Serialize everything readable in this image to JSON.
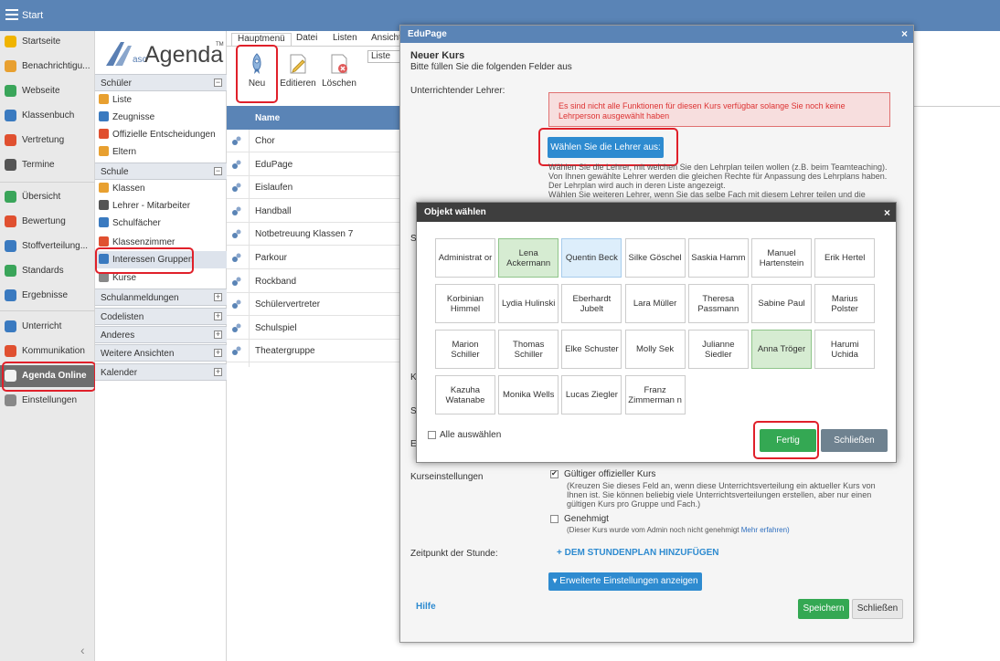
{
  "app": {
    "title": "Start"
  },
  "nav": {
    "items": [
      {
        "label": "Startseite",
        "icon": "star-icon",
        "color": "#f0b400"
      },
      {
        "label": "Benachrichtigu...",
        "icon": "envelope-icon",
        "color": "#e8a030"
      },
      {
        "label": "Webseite",
        "icon": "house-icon",
        "color": "#3aa55a"
      },
      {
        "label": "Klassenbuch",
        "icon": "book-icon",
        "color": "#3a7ac0"
      },
      {
        "label": "Vertretung",
        "icon": "person-icon",
        "color": "#e05030"
      },
      {
        "label": "Termine",
        "icon": "calendar-icon",
        "color": "#555555"
      },
      {
        "label": "Übersicht",
        "icon": "check-circle-icon",
        "color": "#3aa55a"
      },
      {
        "label": "Bewertung",
        "icon": "grade-icon",
        "color": "#e05030"
      },
      {
        "label": "Stoffverteilung...",
        "icon": "list-icon",
        "color": "#3a7ac0"
      },
      {
        "label": "Standards",
        "icon": "shield-icon",
        "color": "#3aa55a"
      },
      {
        "label": "Ergebnisse",
        "icon": "bar-chart-icon",
        "color": "#3a7ac0"
      },
      {
        "label": "Unterricht",
        "icon": "monitor-icon",
        "color": "#3a7ac0"
      },
      {
        "label": "Kommunikation",
        "icon": "chat-icon",
        "color": "#e05030"
      },
      {
        "label": "Agenda Online",
        "icon": "agenda-icon",
        "color": "#ffffff"
      },
      {
        "label": "Einstellungen",
        "icon": "gear-icon",
        "color": "#888888"
      }
    ]
  },
  "logo": {
    "asc": "asc",
    "agenda": "Agenda",
    "tm": "TM"
  },
  "tree": {
    "schueler_header": "Schüler",
    "schueler_items": [
      "Liste",
      "Zeugnisse",
      "Offizielle Entscheidungen",
      "Eltern"
    ],
    "schule_header": "Schule",
    "schule_items": [
      "Klassen",
      "Lehrer - Mitarbeiter",
      "Schulfächer",
      "Klassenzimmer",
      "Interessen Gruppen",
      "Kurse"
    ],
    "collapsed": [
      "Schulanmeldungen",
      "Codelisten",
      "Anderes",
      "Weitere Ansichten",
      "Kalender"
    ],
    "expand_glyph": "+",
    "collapse_glyph": "−"
  },
  "tabs": [
    "Hauptmenü",
    "Datei",
    "Listen",
    "Ansicht"
  ],
  "toolbar": {
    "new": "Neu",
    "edit": "Editieren",
    "delete": "Löschen",
    "liste": "Liste"
  },
  "list": {
    "header": "Name",
    "rows": [
      "Chor",
      "EduPage",
      "Eislaufen",
      "Handball",
      "Notbetreuung Klassen 7",
      "Parkour",
      "Rockband",
      "Schülervertreter",
      "Schulspiel",
      "Theatergruppe"
    ]
  },
  "edupage": {
    "title": "EduPage",
    "close": "×",
    "heading": "Neuer Kurs",
    "subheading": "Bitte füllen Sie die folgenden Felder aus",
    "teacher_label": "Unterrichtender Lehrer:",
    "alert": [
      "Es sind nicht alle Funktionen für diesen Kurs verfügbar solange Sie noch keine",
      "Lehrperson ausgewählt haben"
    ],
    "choose_button": "Wählen Sie die Lehrer aus:",
    "info": [
      "Wählen Sie die Lehrer, mit welchen Sie den Lehrplan teilen wollen (z.B. beim Teamteaching).",
      "Von Ihnen gewählte Lehrer werden die gleichen Rechte für Anpassung des Lehrplans haben.",
      "Der Lehrplan wird auch in deren Liste angezeigt.",
      "Wählen Sie weiteren Lehrer, wenn Sie das selbe Fach mit diesem Lehrer teilen und die"
    ],
    "row_letters": [
      "S",
      "K",
      "S",
      "E"
    ],
    "settings_label": "Kurseinstellungen",
    "official_label": "Gültiger offizieller Kurs",
    "official_help": [
      "(Kreuzen Sie dieses Feld an, wenn diese Unterrichtsverteilung ein aktueller Kurs von",
      "Ihnen ist. Sie können beliebig viele Unterrichtsverteilungen erstellen, aber nur einen",
      "gültigen Kurs pro Gruppe und Fach.)"
    ],
    "approved_label": "Genehmigt",
    "approved_help": "(Dieser Kurs wurde vom Admin noch nicht genehmigt",
    "approved_link": "Mehr erfahren)",
    "lesson_time_label": "Zeitpunkt der Stunde:",
    "add_to_schedule": "+ DEM STUNDENPLAN HINZUFÜGEN",
    "advanced_button": "Erweiterte Einstellungen anzeigen",
    "help": "Hilfe",
    "save": "Speichern",
    "close_button": "Schließen",
    "official_checked": true,
    "approved_checked": false
  },
  "picker": {
    "title": "Objekt wählen",
    "close": "×",
    "teachers": [
      {
        "name": "Administrat or",
        "state": "none"
      },
      {
        "name": "Lena Ackermann",
        "state": "selected"
      },
      {
        "name": "Quentin Beck",
        "state": "highlight"
      },
      {
        "name": "Silke Göschel",
        "state": "none"
      },
      {
        "name": "Saskia Hamm",
        "state": "none"
      },
      {
        "name": "Manuel Hartenstein",
        "state": "none"
      },
      {
        "name": "Erik Hertel",
        "state": "none"
      },
      {
        "name": "Korbinian Himmel",
        "state": "none"
      },
      {
        "name": "Lydia Hulinski",
        "state": "none"
      },
      {
        "name": "Eberhardt Jubelt",
        "state": "none"
      },
      {
        "name": "Lara Müller",
        "state": "none"
      },
      {
        "name": "Theresa Passmann",
        "state": "none"
      },
      {
        "name": "Sabine Paul",
        "state": "none"
      },
      {
        "name": "Marius Polster",
        "state": "none"
      },
      {
        "name": "Marion Schiller",
        "state": "none"
      },
      {
        "name": "Thomas Schiller",
        "state": "none"
      },
      {
        "name": "Elke Schuster",
        "state": "none"
      },
      {
        "name": "Molly Sek",
        "state": "none"
      },
      {
        "name": "Julianne Siedler",
        "state": "none"
      },
      {
        "name": "Anna Tröger",
        "state": "selected"
      },
      {
        "name": "Harumi Uchida",
        "state": "none"
      },
      {
        "name": "Kazuha Watanabe",
        "state": "none"
      },
      {
        "name": "Monika Wells",
        "state": "none"
      },
      {
        "name": "Lucas Ziegler",
        "state": "none"
      },
      {
        "name": "Franz Zimmerman n",
        "state": "none"
      }
    ],
    "select_all": "Alle auswählen",
    "done": "Fertig",
    "close_button": "Schließen"
  },
  "colors": {
    "accent": "#5a84b6",
    "primary_button": "#2e8bd0",
    "success": "#34a853",
    "highlight_outline": "#e0202a",
    "alert_text": "#dd3333"
  }
}
